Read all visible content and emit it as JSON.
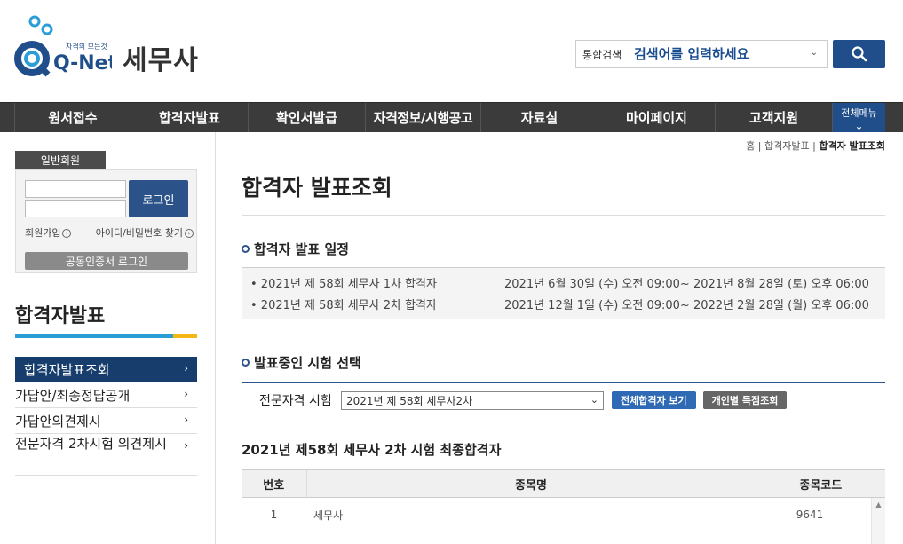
{
  "header": {
    "logo_text": "Q-Net",
    "logo_tagline": "자격의 모든것",
    "site_title": "세무사",
    "search_category": "통합검색",
    "search_placeholder": "검색어를 입력하세요"
  },
  "nav": {
    "items": [
      "원서접수",
      "합격자발표",
      "확인서발급",
      "자격정보/시행공고",
      "자료실",
      "마이페이지",
      "고객지원"
    ],
    "all_menu_label": "전체메뉴"
  },
  "login": {
    "tab_label": "일반회원",
    "login_button": "로그인",
    "signup_link": "회원가입",
    "find_link": "아이디/비밀번호 찾기",
    "cert_button": "공동인증서 로그인"
  },
  "lnb": {
    "title": "합격자발표",
    "items": [
      "합격자발표조회",
      "가답안/최종정답공개",
      "가답안의견제시",
      "전문자격 2차시험 의견제시"
    ]
  },
  "breadcrumb": {
    "home": "홈",
    "sep": "|",
    "level1": "합격자발표",
    "current": "합격자 발표조회"
  },
  "page": {
    "title": "합격자 발표조회"
  },
  "schedule": {
    "title": "합격자 발표 일정",
    "rows": [
      {
        "name": "• 2021년 제 58회 세무사 1차 합격자",
        "period": "2021년 6월 30일 (수) 오전 09:00~ 2021년 8월 28일 (토) 오후 06:00"
      },
      {
        "name": "• 2021년 제 58회 세무사 2차 합격자",
        "period": "2021년 12월 1일 (수) 오전 09:00~ 2022년 2월 28일 (월) 오후 06:00"
      }
    ]
  },
  "exam_select": {
    "title": "발표중인 시험 선택",
    "label": "전문자격 시험",
    "selected": "2021년 제 58회 세무사2차",
    "btn_all": "전체합격자 보기",
    "btn_score": "개인별 득점조회"
  },
  "result": {
    "title": "2021년 제58회 세무사 2차 시험 최종합격자",
    "columns": [
      "번호",
      "종목명",
      "종목코드"
    ],
    "rows": [
      {
        "no": "1",
        "name": "세무사",
        "code": "9641"
      }
    ]
  },
  "colors": {
    "primary": "#1f4e8a",
    "nav_bg": "#3b3b3b",
    "accent_blue": "#2b9ed8",
    "accent_yellow": "#f3b716"
  }
}
